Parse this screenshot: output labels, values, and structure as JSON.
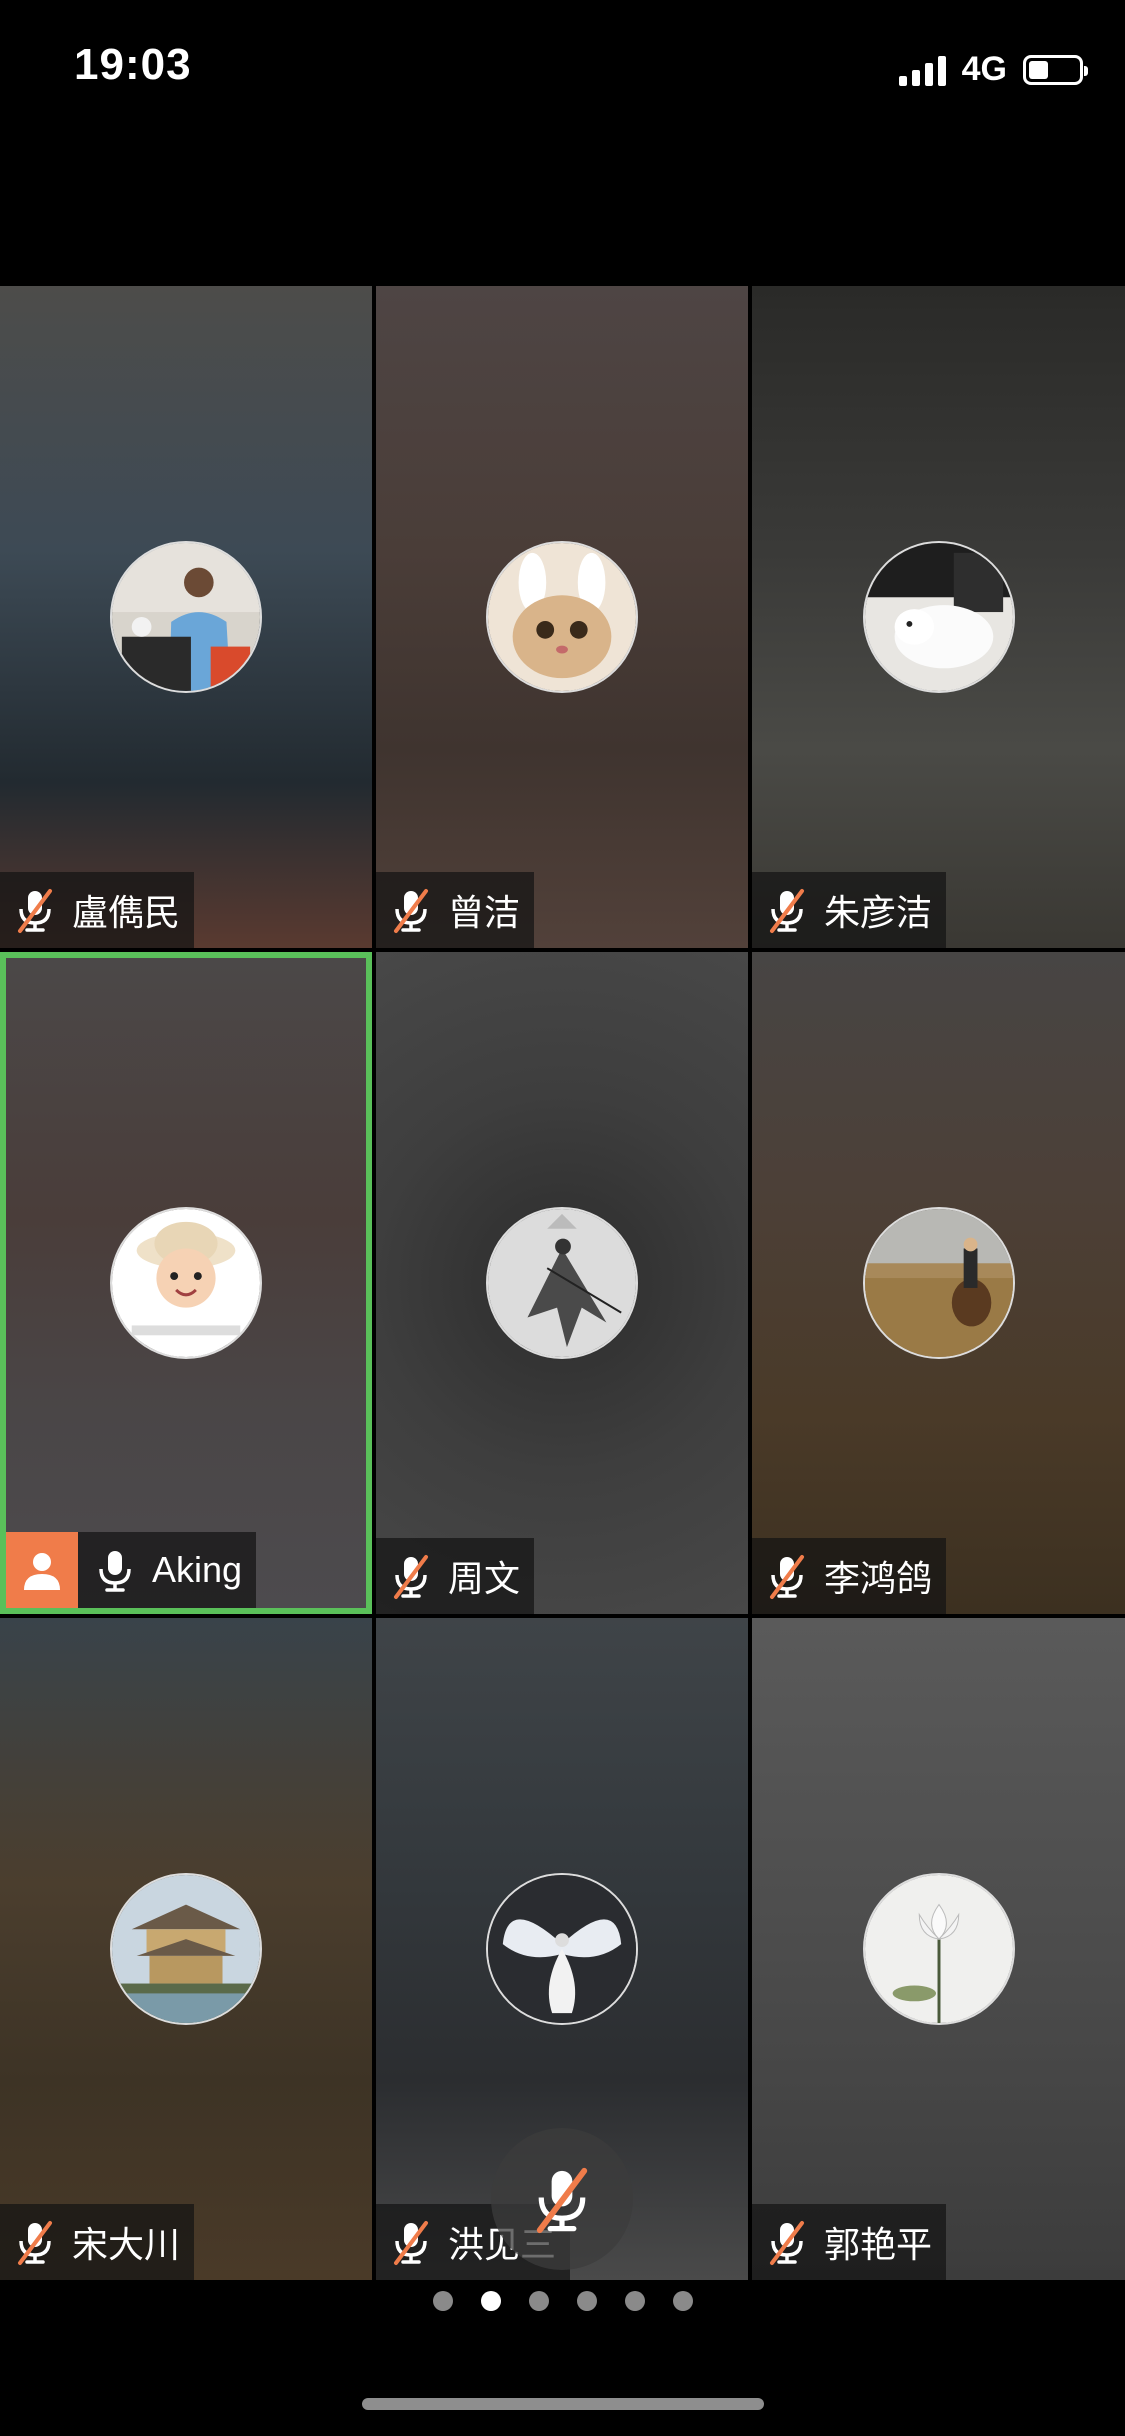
{
  "status_bar": {
    "time": "19:03",
    "network": "4G",
    "signal_bars": 4,
    "battery_level": 0.4
  },
  "tiles": [
    {
      "name": "盧儁民",
      "muted": true,
      "active": false,
      "bg": "linear-gradient(180deg,#4d4c4a 0%,#3d4a55 40%,#222a30 75%,#5a3a30 100%)",
      "avatar": "speaker-at-podium"
    },
    {
      "name": "曾洁",
      "muted": true,
      "active": false,
      "bg": "linear-gradient(180deg,#4e4544 0%,#4a3d38 40%,#3f342f 70%,#52413a 100%)",
      "avatar": "bunny-ear-cat"
    },
    {
      "name": "朱彦洁",
      "muted": true,
      "active": false,
      "bg": "linear-gradient(180deg,#2a2a28 0%,#3a3a38 40%,#4a4a46 70%,#3a3833 100%)",
      "avatar": "white-rabbit"
    },
    {
      "name": "Aking",
      "muted": false,
      "active": true,
      "bg": "linear-gradient(180deg,#4b4848 0%,#4a3d3a 40%,#4a4647 70%,#4d4b4e 100%)",
      "avatar": "child-with-hat"
    },
    {
      "name": "周文",
      "muted": true,
      "active": false,
      "bg": "radial-gradient(circle at 50% 50%,#2c2c2c 0%,#3e3e3e 50%,#484848 100%)",
      "avatar": "warrior-figure"
    },
    {
      "name": "李鸿鸽",
      "muted": true,
      "active": false,
      "bg": "linear-gradient(180deg,#474544 0%,#4c4038 35%,#4a3a28 70%,#3c3020 100%)",
      "avatar": "rider-on-horse"
    },
    {
      "name": "宋大川",
      "muted": true,
      "active": false,
      "bg": "linear-gradient(180deg,#39434a 0%,#4b3e2e 40%,#3d3325 70%,#4a3a28 100%)",
      "avatar": "japanese-temple"
    },
    {
      "name": "洪见三",
      "muted": true,
      "active": false,
      "bg": "linear-gradient(180deg,#3f4448 0%,#33383c 40%,#2b2d30 70%,#4a4a4a 100%)",
      "avatar": "winged-figure"
    },
    {
      "name": "郭艳平",
      "muted": true,
      "active": false,
      "bg": "linear-gradient(180deg,#5a5a5a 0%,#4c4c4c 50%,#3c3c3c 100%)",
      "avatar": "white-lotus"
    }
  ],
  "pager": {
    "count": 6,
    "active_index": 1
  },
  "colors": {
    "active_border": "#5ac05a",
    "mute_slash": "#f07c4a",
    "user_badge": "#f07c4a"
  }
}
